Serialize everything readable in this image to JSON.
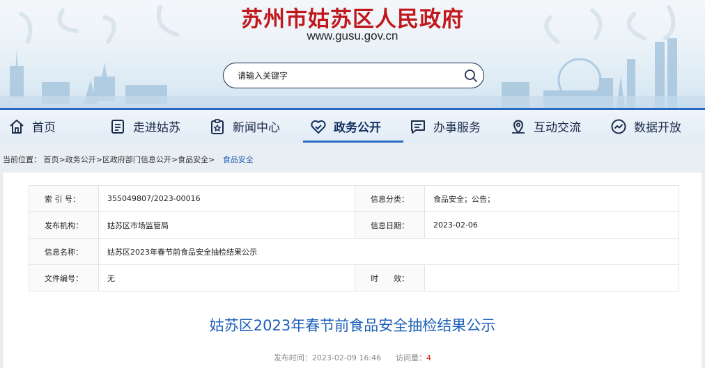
{
  "header": {
    "site_title": "苏州市姑苏区人民政府",
    "site_url": "www.gusu.gov.cn",
    "search_placeholder": "请输入关键字"
  },
  "nav": {
    "items": [
      {
        "label": "首页",
        "icon": "home-icon"
      },
      {
        "label": "走进姑苏",
        "icon": "document-icon"
      },
      {
        "label": "新闻中心",
        "icon": "news-icon"
      },
      {
        "label": "政务公开",
        "icon": "heart-icon",
        "active": true
      },
      {
        "label": "办事服务",
        "icon": "chat-icon"
      },
      {
        "label": "互动交流",
        "icon": "map-pin-icon"
      },
      {
        "label": "数据开放",
        "icon": "trend-icon"
      }
    ]
  },
  "breadcrumb": {
    "prefix": "当前位置：",
    "items": [
      "首页",
      "政务公开",
      "区政府部门信息公开",
      "食品安全"
    ],
    "separator": ">",
    "current": "食品安全"
  },
  "meta": {
    "index_label": "索 引 号：",
    "index_value": "355049807/2023-00016",
    "category_label": "信息分类：",
    "category_value": "食品安全；公告；",
    "org_label": "发布机构：",
    "org_value": "姑苏区市场监管局",
    "date_label": "信息日期：",
    "date_value": "2023-02-06",
    "name_label": "信息名称：",
    "name_value": "姑苏区2023年春节前食品安全抽检结果公示",
    "docno_label": "文件编号：",
    "docno_value": "无",
    "validity_label": "时　　效：",
    "validity_value": ""
  },
  "article": {
    "title": "姑苏区2023年春节前食品安全抽检结果公示",
    "publish_label": "发布时间：",
    "publish_time": "2023-02-09 16:46",
    "views_label": "访问量：",
    "views": "4"
  },
  "colors": {
    "title_red": "#c0181c",
    "nav_blue": "#2a6ac0",
    "link_blue": "#1d5fb8",
    "count_red": "#d81e06"
  }
}
